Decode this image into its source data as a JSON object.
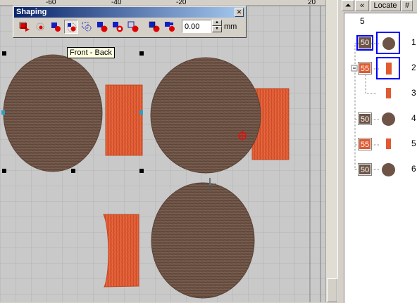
{
  "colors": {
    "canvas_bg": "#c9c9c9",
    "grid": "#b4b4b4",
    "brown": "#6e5446",
    "orange": "#e05a32",
    "selection_blue": "#0000ff"
  },
  "ruler": {
    "labels": [
      "-60",
      "-40",
      "-20",
      "20"
    ]
  },
  "shaping": {
    "title": "Shaping",
    "close_glyph": "✕",
    "value": "0.00",
    "unit": "mm",
    "spin_up": "▲",
    "spin_down": "▼",
    "tools": [
      {
        "icon": "front-to-back-icon"
      },
      {
        "icon": "back-to-front-icon"
      },
      {
        "icon": "move-front-icon"
      },
      {
        "icon": "front-back-icon",
        "pressed": true
      },
      {
        "icon": "back-icon"
      },
      {
        "icon": "front-minus-back-icon"
      },
      {
        "icon": "back-minus-front-icon"
      },
      {
        "icon": "intersect-icon"
      },
      {
        "icon": "combine-icon"
      },
      {
        "icon": "break-apart-icon"
      }
    ],
    "tooltip": "Front - Back"
  },
  "panel": {
    "toolbar": [
      "⏶",
      "«",
      "Locate",
      "#"
    ],
    "header": "5",
    "rows": [
      {
        "code": "50",
        "color": "#6e5446",
        "shape": "circle",
        "number": "1",
        "selected": true
      },
      {
        "code": "55",
        "color": "#e05a32",
        "shape": "bar",
        "number": "2",
        "selected": true,
        "group": true
      },
      {
        "code": "",
        "color": "#e05a32",
        "shape": "bar",
        "number": "3",
        "selected": false,
        "child": true
      },
      {
        "code": "50",
        "color": "#6e5446",
        "shape": "circle",
        "number": "4",
        "selected": false
      },
      {
        "code": "55",
        "color": "#e05a32",
        "shape": "bar",
        "number": "5",
        "selected": false
      },
      {
        "code": "50",
        "color": "#6e5446",
        "shape": "circle",
        "number": "6",
        "selected": false
      }
    ]
  }
}
